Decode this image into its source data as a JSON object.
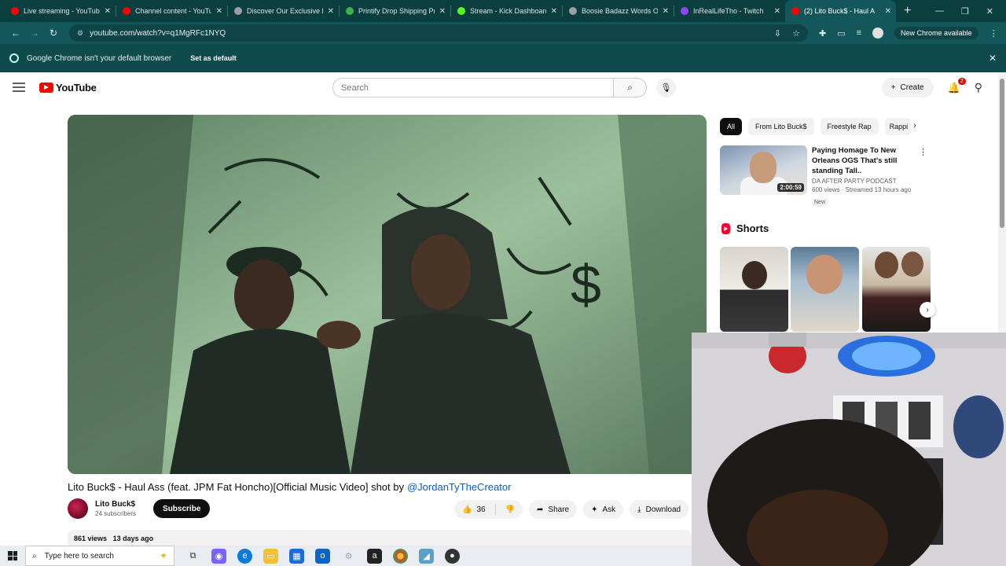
{
  "browser": {
    "tabs": [
      {
        "title": "Live streaming - YouTube",
        "color": "#ff0000"
      },
      {
        "title": "Channel content - YouTube",
        "color": "#ff0000"
      },
      {
        "title": "Discover Our Exclusive Ra",
        "color": "#9aa0a6"
      },
      {
        "title": "Printify Drop Shipping Pri",
        "color": "#39b54a"
      },
      {
        "title": "Stream - Kick Dashboard",
        "color": "#53fc18"
      },
      {
        "title": "Boosie Badazz Words Of A",
        "color": "#9aa0a6"
      },
      {
        "title": "InRealLifeTho - Twitch",
        "color": "#9146ff"
      },
      {
        "title": "(2) Lito Buck$ - Haul A",
        "color": "#ff0000",
        "active": true
      }
    ],
    "url": "youtube.com/watch?v=q1MgRFc1NYQ",
    "new_chrome_label": "New Chrome available",
    "infobar_text": "Google Chrome isn't your default browser",
    "infobar_button": "Set as default"
  },
  "youtube": {
    "logo_text": "YouTube",
    "search_placeholder": "Search",
    "create_label": "Create",
    "notification_count": "2",
    "video": {
      "title": "Lito Buck$ - Haul Ass (feat. JPM Fat Honcho)[Official Music Video] shot by",
      "mention": "@JordanTyTheCreator",
      "channel_name": "Lito Buck$",
      "subscribers": "24 subscribers",
      "subscribe_label": "Subscribe",
      "likes": "36",
      "share_label": "Share",
      "ask_label": "Ask",
      "download_label": "Download",
      "views": "861 views",
      "age": "13 days ago"
    },
    "chips": [
      "All",
      "From Lito Buck$",
      "Freestyle Rap",
      "Rappi"
    ],
    "recommendation": {
      "title": "Paying Homage To New Orleans OGS That's still standing Tall..",
      "channel": "DA AFTER PARTY PODCAST",
      "stats": "600 views · Streamed 13 hours ago",
      "badge": "New",
      "duration": "2:00:59"
    },
    "shorts_heading": "Shorts"
  },
  "taskbar": {
    "search_placeholder": "Type here to search"
  }
}
